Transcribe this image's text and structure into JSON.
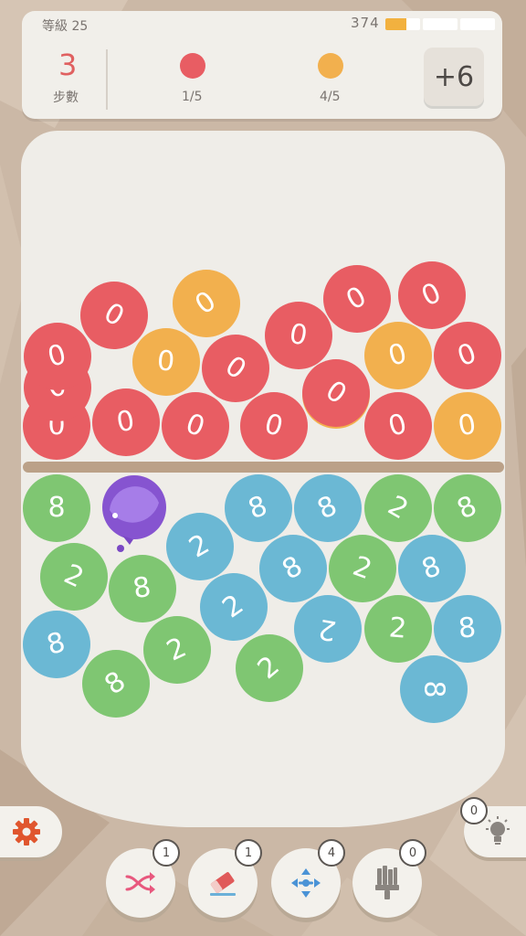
{
  "header": {
    "level_label": "等級 25",
    "score": "374",
    "progress_fraction": 0.2
  },
  "goals": {
    "moves_value": "3",
    "moves_label": "步數",
    "items": [
      {
        "color": "#e85d63",
        "count": "1/5"
      },
      {
        "color": "#f2b04e",
        "count": "4/5"
      }
    ],
    "bonus_label": "+6"
  },
  "colors": {
    "red": "#e85d63",
    "orange": "#f2b04e",
    "green": "#7fc672",
    "blue": "#6bb8d4",
    "purple": "#8654d0"
  },
  "balls_top": [
    {
      "c": "red",
      "n": "0"
    },
    {
      "c": "red",
      "n": "0"
    },
    {
      "c": "red",
      "n": "0"
    },
    {
      "c": "red",
      "n": "0"
    },
    {
      "c": "red",
      "n": "0"
    },
    {
      "c": "orange",
      "n": "0"
    },
    {
      "c": "red",
      "n": "0"
    },
    {
      "c": "orange",
      "n": "0"
    },
    {
      "c": "red",
      "n": "0"
    },
    {
      "c": "red",
      "n": "0"
    },
    {
      "c": "orange",
      "n": "0"
    },
    {
      "c": "orange",
      "n": "0"
    },
    {
      "c": "red",
      "n": "0"
    },
    {
      "c": "red",
      "n": "0"
    },
    {
      "c": "orange",
      "n": "0"
    },
    {
      "c": "red",
      "n": "0"
    },
    {
      "c": "red",
      "n": "0"
    },
    {
      "c": "red",
      "n": "0"
    },
    {
      "c": "red",
      "n": "0"
    }
  ],
  "balls_bottom": [
    {
      "c": "green",
      "n": "8"
    },
    {
      "c": "blue",
      "n": "8"
    },
    {
      "c": "blue",
      "n": "8"
    },
    {
      "c": "green",
      "n": "2"
    },
    {
      "c": "green",
      "n": "8"
    },
    {
      "c": "blue",
      "n": "2"
    },
    {
      "c": "green",
      "n": "2"
    },
    {
      "c": "green",
      "n": "8"
    },
    {
      "c": "blue",
      "n": "8"
    },
    {
      "c": "green",
      "n": "2"
    },
    {
      "c": "blue",
      "n": "8"
    },
    {
      "c": "blue",
      "n": "2"
    },
    {
      "c": "blue",
      "n": "8"
    },
    {
      "c": "blue",
      "n": "2"
    },
    {
      "c": "green",
      "n": "2"
    },
    {
      "c": "blue",
      "n": "8"
    },
    {
      "c": "green",
      "n": "2"
    },
    {
      "c": "green",
      "n": "8"
    },
    {
      "c": "green",
      "n": "2"
    },
    {
      "c": "blue",
      "n": "8"
    }
  ],
  "tools": [
    {
      "name": "shuffle-tool",
      "icon": "shuffle-icon",
      "count": "1"
    },
    {
      "name": "eraser-tool",
      "icon": "eraser-icon",
      "count": "1"
    },
    {
      "name": "move-tool",
      "icon": "move-arrows-icon",
      "count": "4"
    },
    {
      "name": "brush-tool",
      "icon": "paint-brush-icon",
      "count": "0"
    }
  ],
  "hint": {
    "icon": "lightbulb-icon",
    "count": "0"
  }
}
